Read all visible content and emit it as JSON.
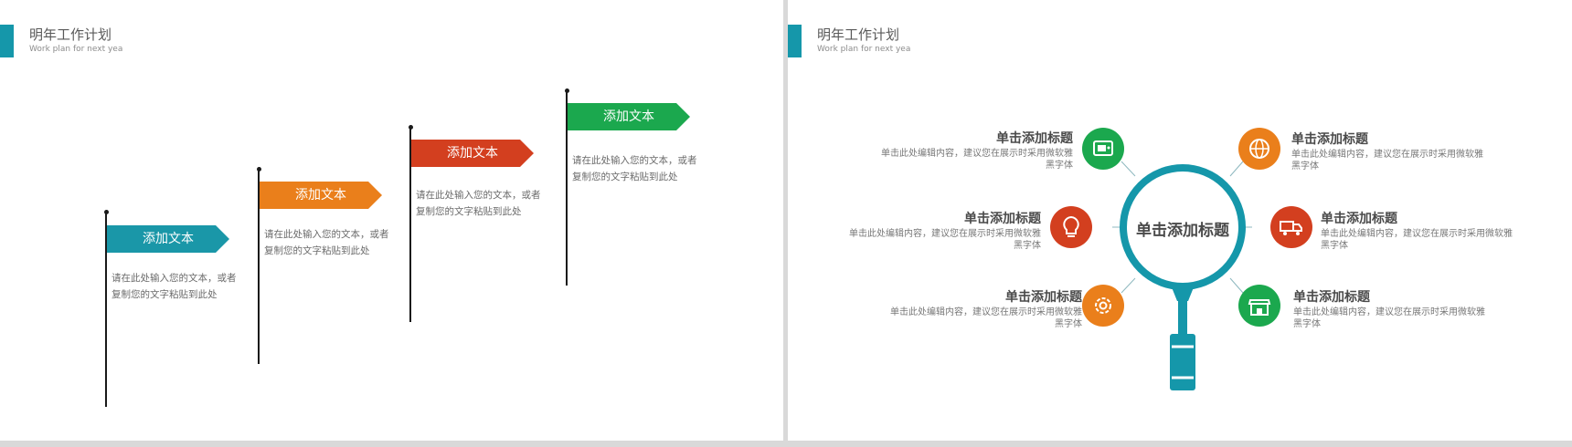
{
  "left_slide": {
    "title": "明年工作计划",
    "subtitle": "Work plan for next yea",
    "flags": [
      {
        "label": "添加文本",
        "color": "#1a97a8",
        "text": "请在此处输入您的文本，或者复制您的文字粘贴到此处"
      },
      {
        "label": "添加文本",
        "color": "#ea7f1b",
        "text": "请在此处输入您的文本，或者复制您的文字粘贴到此处"
      },
      {
        "label": "添加文本",
        "color": "#d33f1f",
        "text": "请在此处输入您的文本，或者复制您的文字粘贴到此处"
      },
      {
        "label": "添加文本",
        "color": "#1ba84e",
        "text": "请在此处输入您的文本，或者复制您的文字粘贴到此处"
      }
    ]
  },
  "right_slide": {
    "title": "明年工作计划",
    "subtitle": "Work plan for next yea",
    "center_title": "单击添加标题",
    "items": [
      {
        "title": "单击添加标题",
        "desc": "单击此处编辑内容，建议您在展示时采用微软雅黑字体",
        "icon": "tv-icon",
        "color": "#1ba84e"
      },
      {
        "title": "单击添加标题",
        "desc": "单击此处编辑内容，建议您在展示时采用微软雅黑字体",
        "icon": "lightbulb-icon",
        "color": "#d33f1f"
      },
      {
        "title": "单击添加标题",
        "desc": "单击此处编辑内容，建议您在展示时采用微软雅黑字体",
        "icon": "gear-icon",
        "color": "#ea7f1b"
      },
      {
        "title": "单击添加标题",
        "desc": "单击此处编辑内容，建议您在展示时采用微软雅黑字体",
        "icon": "globe-icon",
        "color": "#ea7f1b"
      },
      {
        "title": "单击添加标题",
        "desc": "单击此处编辑内容，建议您在展示时采用微软雅黑字体",
        "icon": "truck-icon",
        "color": "#d33f1f"
      },
      {
        "title": "单击添加标题",
        "desc": "单击此处编辑内容，建议您在展示时采用微软雅黑字体",
        "icon": "store-icon",
        "color": "#1ba84e"
      }
    ],
    "magnifier_color": "#1597aa"
  }
}
